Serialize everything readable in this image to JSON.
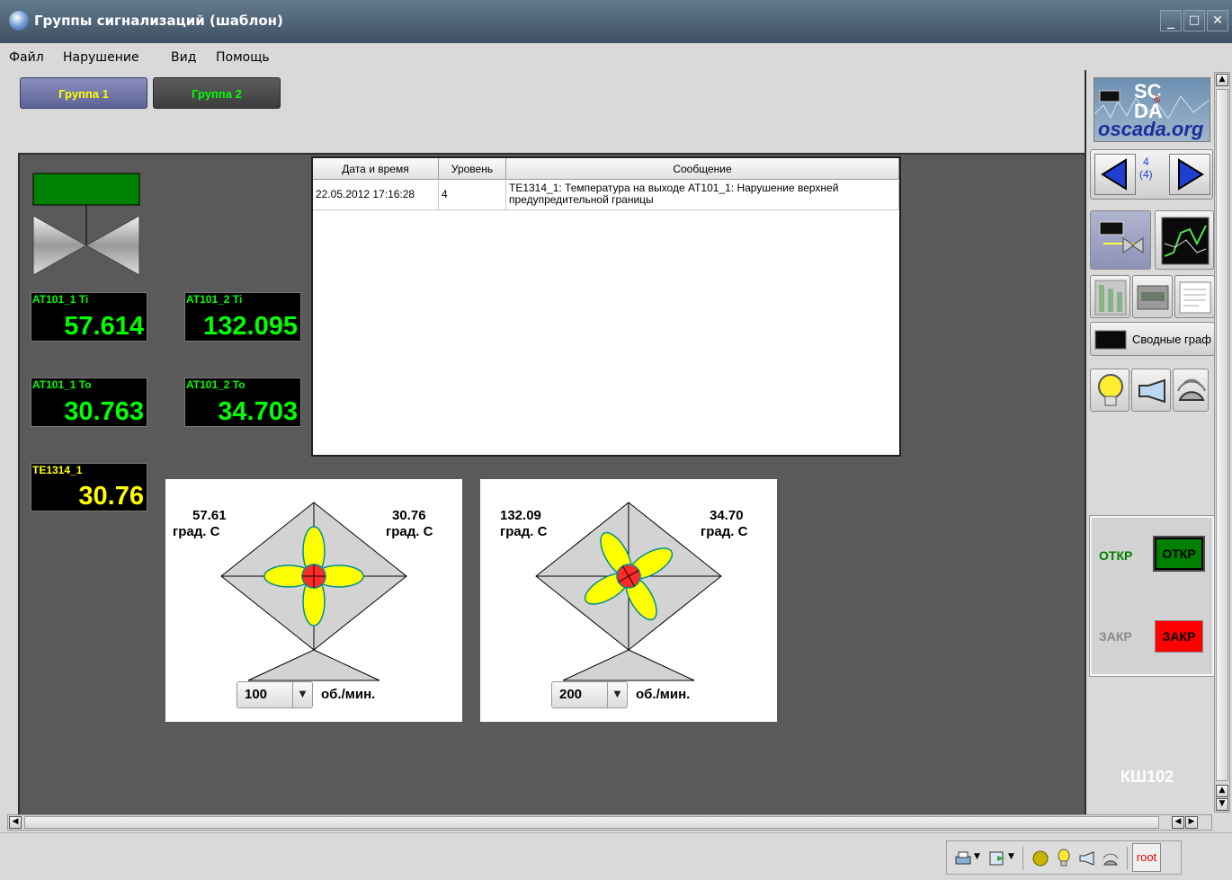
{
  "window": {
    "title": "Группы сигнализаций (шаблон)",
    "min": "_",
    "max": "□",
    "close": "✕"
  },
  "menu": [
    "Файл",
    "Нарушение",
    "Вид",
    "Помощь"
  ],
  "groups": [
    {
      "label": "Группа 1",
      "color": "#ffff00"
    },
    {
      "label": "Группа 2",
      "color": "#00ff00"
    }
  ],
  "displays": [
    {
      "label": "AT101_1 Ti",
      "value": "57.614",
      "color": "#00ff00"
    },
    {
      "label": "AT101_2 Ti",
      "value": "132.095",
      "color": "#00ff00"
    },
    {
      "label": "AT101_1 To",
      "value": "30.763",
      "color": "#00ff00"
    },
    {
      "label": "AT101_2 To",
      "value": "34.703",
      "color": "#00ff00"
    },
    {
      "label": "TE1314_1",
      "value": "30.76",
      "color": "#ffff00"
    }
  ],
  "table": {
    "headers": [
      "Дата и время",
      "Уровень",
      "Сообщение"
    ],
    "rows": [
      {
        "date": "22.05.2012 17:16:28",
        "level": "4",
        "message": "TE1314_1: Температура на выходе AT101_1: Нарушение верхней предупредительной границы"
      }
    ]
  },
  "fans": [
    {
      "left_value": "57.61",
      "right_value": "30.76",
      "unit": "град. С",
      "speed": "100",
      "speed_unit": "об./мин."
    },
    {
      "left_value": "132.09",
      "right_value": "34.70",
      "unit": "град. С",
      "speed": "200",
      "speed_unit": "об./мин."
    }
  ],
  "right": {
    "logo": {
      "line1": "SC",
      "line2": "DA",
      "amp": "&",
      "site": "oscada.org"
    },
    "page_current": "4",
    "page_total": "(4)",
    "summary_label": "Сводные граф",
    "valve_open_label": "ОТКР",
    "valve_open_button": "ОТКР",
    "valve_close_label": "ЗАКР",
    "valve_close_button": "ЗАКР",
    "object_name": "КШ102"
  },
  "status": {
    "user": "root"
  },
  "colors": {
    "accent_green": "#00ff00",
    "alarm_yellow": "#ffff00",
    "close_red": "#ff0000",
    "valve_green": "#008000"
  }
}
